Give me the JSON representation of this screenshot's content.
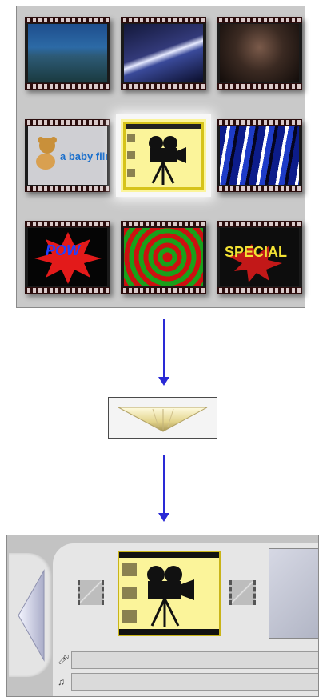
{
  "grid": {
    "thumbnails": [
      {
        "name": "thumb-ocean",
        "text": ""
      },
      {
        "name": "thumb-pier",
        "text": ""
      },
      {
        "name": "thumb-crowd",
        "text": ""
      },
      {
        "name": "thumb-baby-film",
        "text": "a baby film"
      },
      {
        "name": "thumb-camera",
        "text": "",
        "selected": true
      },
      {
        "name": "thumb-blue-stripes",
        "text": ""
      },
      {
        "name": "thumb-pow",
        "text": "POW"
      },
      {
        "name": "thumb-spiral",
        "text": ""
      },
      {
        "name": "thumb-special",
        "text": "SPECIAL"
      }
    ]
  },
  "icons": {
    "camera": "movie-camera-icon",
    "voice": "microphone-icon",
    "music": "music-note-icon",
    "nav_left": "triangle-left-icon",
    "drop": "triangle-down-icon"
  },
  "colors": {
    "arrow": "#2a2ad6",
    "selection": "#d6c31a",
    "clip_bg": "#fbf49a"
  }
}
